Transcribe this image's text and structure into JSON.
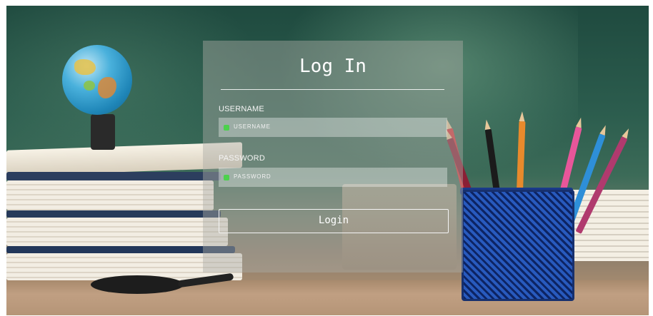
{
  "login_panel": {
    "title": "Log In",
    "username": {
      "label": "USERNAME",
      "placeholder": "USERNAME",
      "icon": "user-icon"
    },
    "password": {
      "label": "PASSWORD",
      "placeholder": "PASSWORD",
      "icon": "lock-icon"
    },
    "submit_label": "Login"
  },
  "colors": {
    "panel_overlay": "#aaaaa5",
    "field_icon": "#4cd14c",
    "text": "#ffffff"
  }
}
